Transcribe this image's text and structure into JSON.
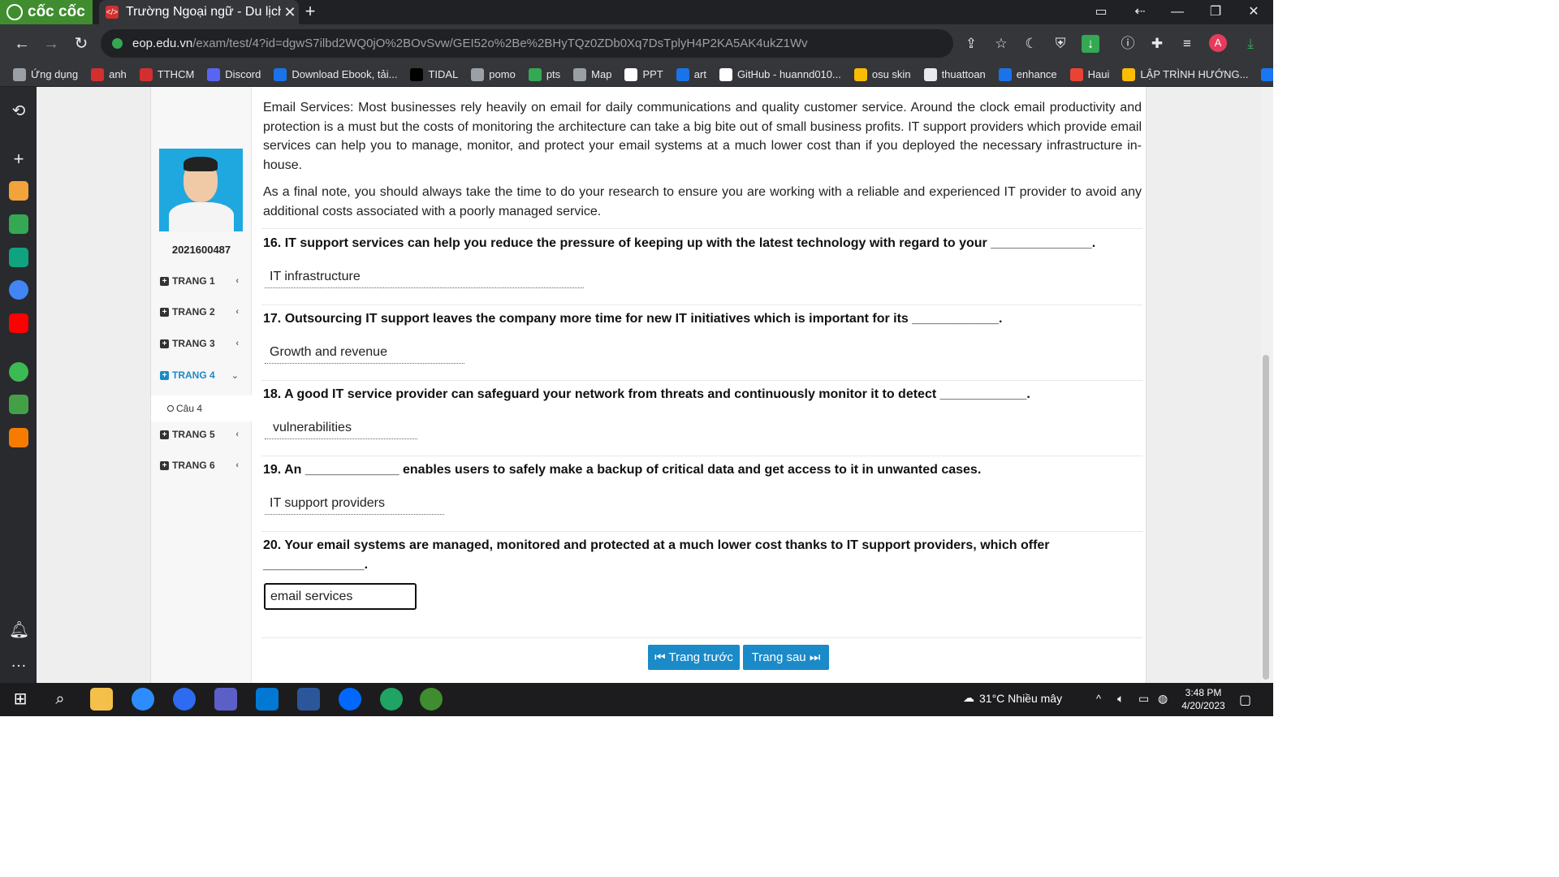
{
  "browser": {
    "brand": "cốc cốc",
    "tab_title": "Trường Ngoại ngữ - Du lịch",
    "tab_close": "✕",
    "new_tab": "+",
    "url_host": "eop.edu.vn",
    "url_path": "/exam/test/4?id=dgwS7ilbd2WQ0jO%2BOvSvw/GEI52o%2Be%2BHyTQz0ZDb0Xq7DsTplyH4P2KA5AK4ukZ1Wv",
    "profile_initial": "A"
  },
  "bookmarks": [
    {
      "label": "Ứng dụng",
      "color": "#9aa0a6"
    },
    {
      "label": "anh",
      "color": "#d32f2f"
    },
    {
      "label": "TTHCM",
      "color": "#d32f2f"
    },
    {
      "label": "Discord",
      "color": "#5865f2"
    },
    {
      "label": "Download Ebook, tải...",
      "color": "#1a73e8"
    },
    {
      "label": "TIDAL",
      "color": "#000000"
    },
    {
      "label": "pomo",
      "color": "#9aa0a6"
    },
    {
      "label": "pts",
      "color": "#34a853"
    },
    {
      "label": "Map",
      "color": "#9aa0a6"
    },
    {
      "label": "PPT",
      "color": "#ffffff"
    },
    {
      "label": "art",
      "color": "#1a73e8"
    },
    {
      "label": "GitHub - huannd010...",
      "color": "#ffffff"
    },
    {
      "label": "osu skin",
      "color": "#fbbc04"
    },
    {
      "label": "thuattoan",
      "color": "#e8eaed"
    },
    {
      "label": "enhance",
      "color": "#1a73e8"
    },
    {
      "label": "Haui",
      "color": "#ea4335"
    },
    {
      "label": "LẬP TRÌNH HƯỚNG...",
      "color": "#fbbc04"
    },
    {
      "label": "I",
      "color": "#1877f2"
    }
  ],
  "student": {
    "id": "2021600487"
  },
  "pages": [
    {
      "label": "TRANG 1",
      "chevron": "‹",
      "active": false
    },
    {
      "label": "TRANG 2",
      "chevron": "‹",
      "active": false
    },
    {
      "label": "TRANG 3",
      "chevron": "‹",
      "active": false
    },
    {
      "label": "TRANG 4",
      "chevron": "⌄",
      "active": true
    },
    {
      "label": "TRANG 5",
      "chevron": "‹",
      "active": false
    },
    {
      "label": "TRANG 6",
      "chevron": "‹",
      "active": false
    }
  ],
  "sub_item": "Câu 4",
  "passage": [
    "Email Services: Most businesses rely heavily on email for daily communications and quality customer service. Around the clock email productivity and protection is a must but the costs of monitoring the architecture can take a big bite out of small business profits. IT support providers which provide email services can help you to manage, monitor, and protect your email systems at a much lower cost than if you deployed the necessary infrastructure in-house.",
    "As a final note, you should always take the time to do your research to ensure you are working with a reliable and experienced IT provider to avoid any additional costs associated with a poorly managed service."
  ],
  "questions": [
    {
      "text": "16. IT support services can help you reduce the pressure of keeping up with the latest technology with regard to your ______________.",
      "answer": "IT infrastructure"
    },
    {
      "text": "17. Outsourcing IT support leaves the company more time for new IT initiatives which is important for its ____________.",
      "answer": "Growth and revenue"
    },
    {
      "text": "18. A good IT service provider can safeguard your network from threats and continuously monitor it to detect ____________.",
      "answer": "vulnerabilities"
    },
    {
      "text": "19. An _____________ enables users to safely make a backup of critical data and get access to it in unwanted cases.",
      "answer": "IT support providers"
    },
    {
      "text": "20. Your email systems are managed, monitored and protected at a much lower cost thanks to IT support providers, which offer ______________.",
      "answer": "email services"
    }
  ],
  "buttons": {
    "prev": "⏮ Trang trước",
    "next": "Trang sau ⏭"
  },
  "taskbar": {
    "weather": "31°C  Nhiều mây",
    "time": "3:48 PM",
    "date": "4/20/2023"
  }
}
